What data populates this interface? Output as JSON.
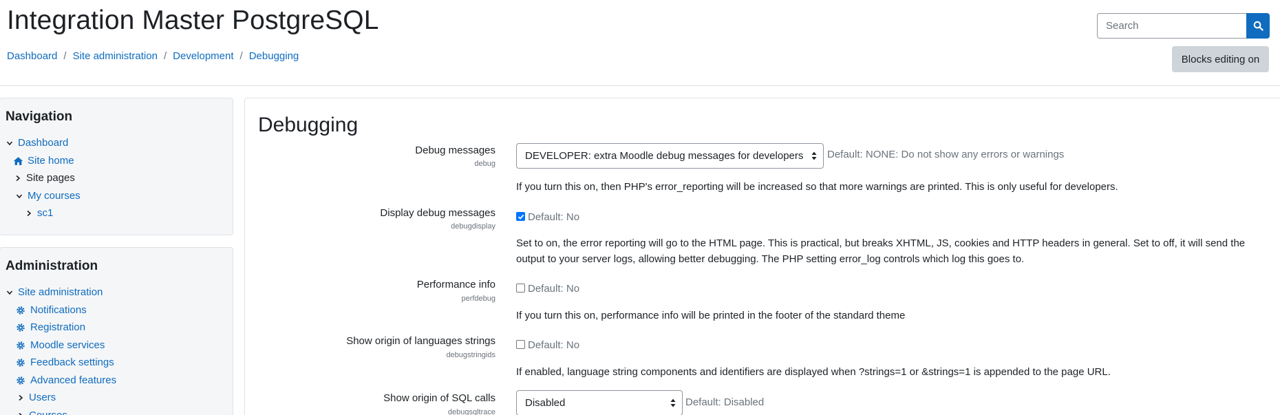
{
  "site": {
    "title": "Integration Master PostgreSQL"
  },
  "breadcrumb": [
    "Dashboard",
    "Site administration",
    "Development",
    "Debugging"
  ],
  "search": {
    "placeholder": "Search"
  },
  "header": {
    "blocks_editing_label": "Blocks editing on"
  },
  "navigation": {
    "title": "Navigation",
    "items": [
      {
        "label": "Dashboard",
        "icon": "chevron-down-icon",
        "link": true
      },
      {
        "label": "Site home",
        "icon": "home-icon",
        "link": true
      },
      {
        "label": "Site pages",
        "icon": "chevron-right-icon",
        "link": false
      },
      {
        "label": "My courses",
        "icon": "chevron-down-icon",
        "link": true
      },
      {
        "label": "sc1",
        "icon": "chevron-right-icon",
        "link": true
      }
    ]
  },
  "administration": {
    "title": "Administration",
    "items": [
      {
        "label": "Site administration",
        "icon": "chevron-down-icon"
      },
      {
        "label": "Notifications",
        "icon": "gear-icon"
      },
      {
        "label": "Registration",
        "icon": "gear-icon"
      },
      {
        "label": "Moodle services",
        "icon": "gear-icon"
      },
      {
        "label": "Feedback settings",
        "icon": "gear-icon"
      },
      {
        "label": "Advanced features",
        "icon": "gear-icon"
      },
      {
        "label": "Users",
        "icon": "chevron-right-icon"
      },
      {
        "label": "Courses",
        "icon": "chevron-right-icon"
      }
    ]
  },
  "page": {
    "heading": "Debugging"
  },
  "settings": {
    "debug": {
      "label": "Debug messages",
      "key": "debug",
      "value": "DEVELOPER: extra Moodle debug messages for developers",
      "default": "Default: NONE: Do not show any errors or warnings",
      "description": "If you turn this on, then PHP's error_reporting will be increased so that more warnings are printed. This is only useful for developers."
    },
    "debugdisplay": {
      "label": "Display debug messages",
      "key": "debugdisplay",
      "checked": true,
      "default": "Default: No",
      "description": "Set to on, the error reporting will go to the HTML page. This is practical, but breaks XHTML, JS, cookies and HTTP headers in general. Set to off, it will send the output to your server logs, allowing better debugging. The PHP setting error_log controls which log this goes to."
    },
    "perfdebug": {
      "label": "Performance info",
      "key": "perfdebug",
      "checked": false,
      "default": "Default: No",
      "description": "If you turn this on, performance info will be printed in the footer of the standard theme"
    },
    "debugstringids": {
      "label": "Show origin of languages strings",
      "key": "debugstringids",
      "checked": false,
      "default": "Default: No",
      "description": "If enabled, language string components and identifiers are displayed when ?strings=1 or &strings=1 is appended to the page URL."
    },
    "debugsqltrace": {
      "label": "Show origin of SQL calls",
      "key": "debugsqltrace",
      "value": "Disabled",
      "default": "Default: Disabled"
    }
  },
  "colors": {
    "accent": "#0f6cbf",
    "text": "#1d2125",
    "muted": "#6a737b",
    "block_bg": "#f5f6f7",
    "button_secondary": "#ced4da"
  }
}
